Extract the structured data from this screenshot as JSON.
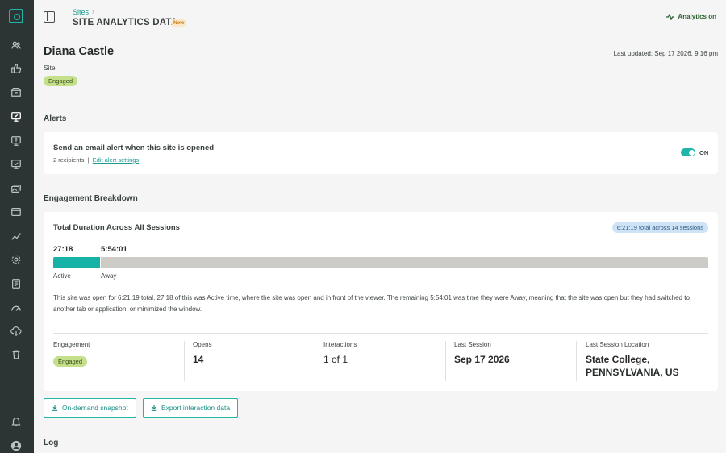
{
  "header": {
    "breadcrumb": "Sites",
    "breadcrumb_sep": "›",
    "title": "SITE ANALYTICS DATA",
    "new_badge": "New",
    "analytics_status": "Analytics on"
  },
  "sidebar": {
    "icons": [
      "logo-icon",
      "users-icon",
      "thumbs-up-icon",
      "inbox-icon",
      "presentation-icon",
      "screen-share-icon",
      "screen-check-icon",
      "images-icon",
      "browser-window-icon",
      "trend-icon",
      "settings-icon",
      "document-icon",
      "gauge-icon",
      "cloud-download-icon",
      "trash-icon",
      "bell-icon",
      "account-icon"
    ],
    "active": "presentation-icon"
  },
  "site": {
    "name": "Diana Castle",
    "kind": "Site",
    "status": "Engaged",
    "last_updated": "Last updated: Sep 17 2026, 9:16 pm"
  },
  "alerts": {
    "section_title": "Alerts",
    "title": "Send an email alert when this site is opened",
    "recipients": "2 recipients",
    "separator": "|",
    "edit_link": "Edit alert settings",
    "toggle_label": "ON",
    "toggle_on": true
  },
  "engagement": {
    "section_title": "Engagement Breakdown",
    "duration_title": "Total Duration Across All Sessions",
    "total_pill": "6:21:19 total across 14 sessions",
    "active_value": "27:18",
    "away_value": "5:54:01",
    "active_label": "Active",
    "away_label": "Away",
    "active_fraction": 0.0716,
    "description": "This site was open for 6:21:19 total. 27:18 of this was Active time, where the site was open and in front of the viewer. The remaining 5:54:01 was time they were Away, meaning that the site was open but they had switched to another tab or application, or minimized the window.",
    "stats": {
      "engagement_label": "Engagement",
      "engagement_value": "Engaged",
      "opens_label": "Opens",
      "opens_value": "14",
      "interactions_label": "Interactions",
      "interactions_value": "1 of 1",
      "last_session_label": "Last Session",
      "last_session_value": "Sep 17 2026",
      "location_label": "Last Session Location",
      "location_value": "State College, PENNSYLVANIA, US"
    }
  },
  "actions": {
    "snapshot_label": "On-demand snapshot",
    "export_label": "Export interaction data"
  },
  "log": {
    "section_title": "Log"
  },
  "colors": {
    "accent": "#1fb5a9",
    "active_bar": "#17b2a6",
    "away_bar": "#cdcbc6",
    "engaged_badge": "#c4e08a",
    "sidebar_bg": "#2c3434"
  }
}
